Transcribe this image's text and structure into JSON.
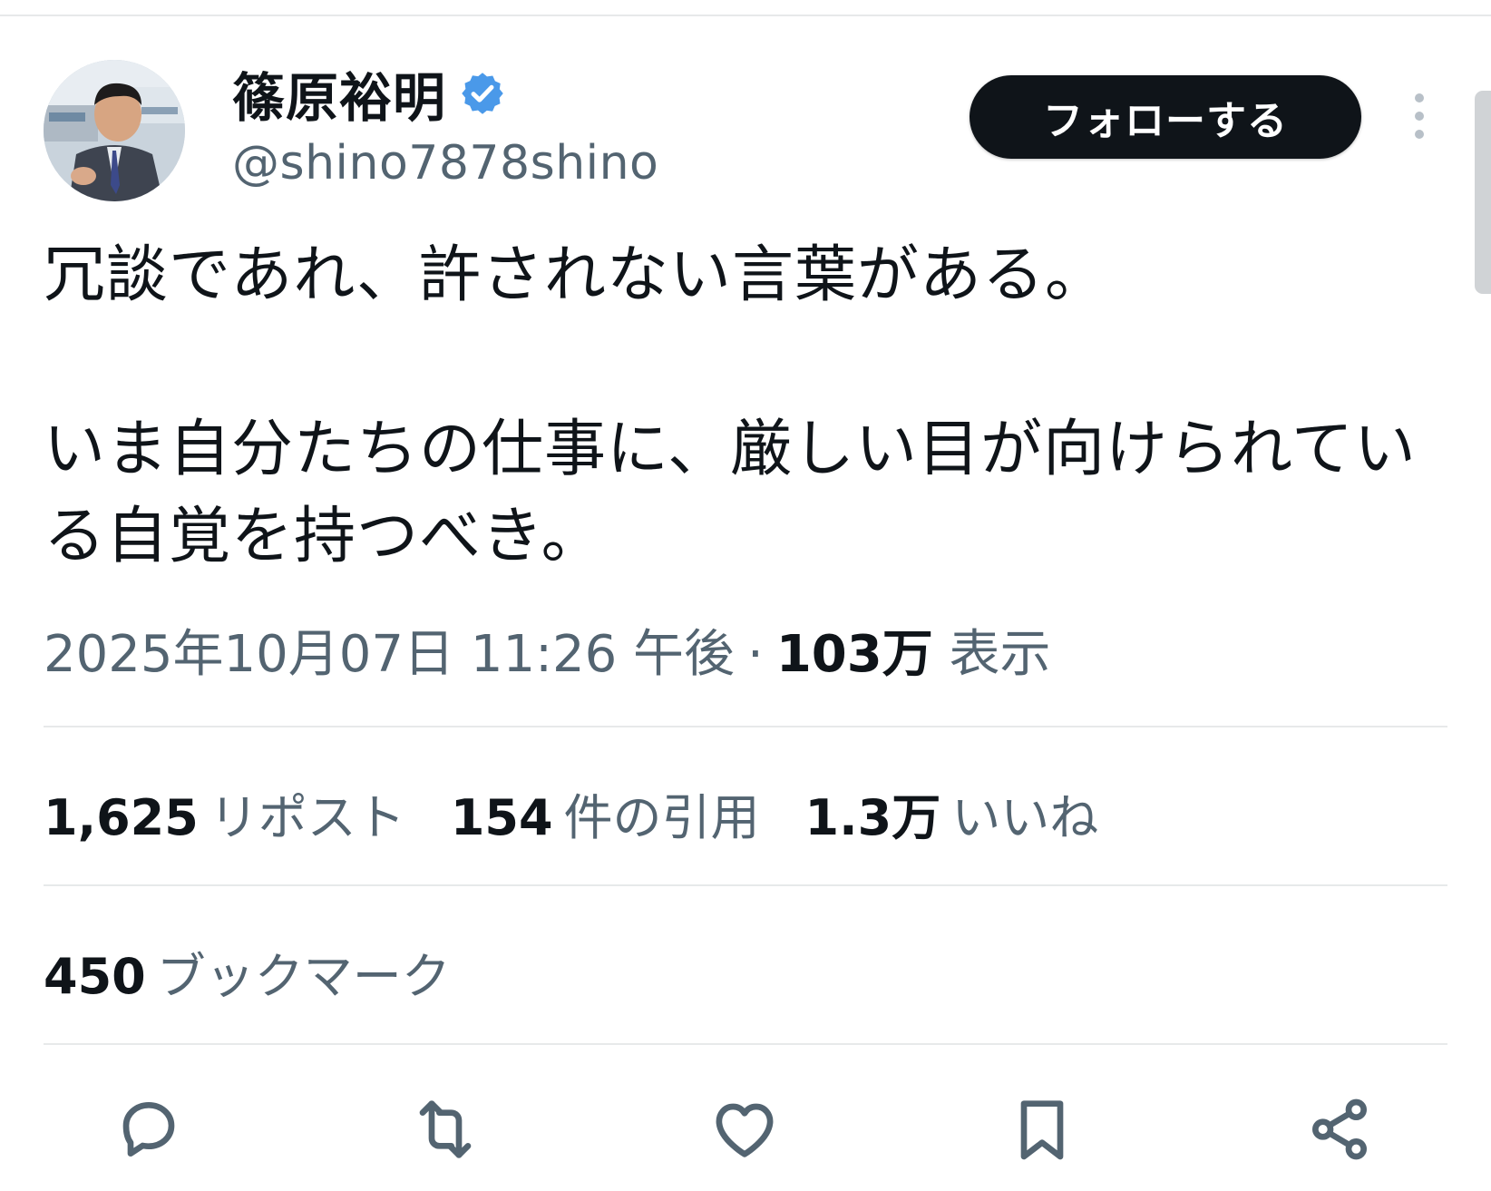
{
  "author": {
    "name": "篠原裕明",
    "handle": "@shino7878shino",
    "verified": true,
    "verified_color": "#4a99e9"
  },
  "follow_label": "フォローする",
  "tweet": {
    "text": "冗談であれ、許されない言葉がある。\n\nいま自分たちの仕事に、厳しい目が向けられている自覚を持つべき。"
  },
  "meta": {
    "datetime": "2025年10月07日 11:26 午後",
    "separator": "·",
    "views_count": "103万",
    "views_label": "表示"
  },
  "stats": {
    "reposts": {
      "count": "1,625",
      "label": "リポスト"
    },
    "quotes": {
      "count": "154",
      "label": "件の引用"
    },
    "likes": {
      "count": "1.3万",
      "label": "いいね"
    },
    "bookmarks": {
      "count": "450",
      "label": "ブックマーク"
    }
  },
  "actions": [
    {
      "icon": "reply-icon"
    },
    {
      "icon": "repost-icon"
    },
    {
      "icon": "like-icon"
    },
    {
      "icon": "bookmark-icon"
    },
    {
      "icon": "share-icon"
    }
  ],
  "colors": {
    "text": "#0f1419",
    "secondary": "#536471",
    "divider": "#e7e9ea",
    "follow_bg": "#0f1419",
    "follow_text": "#ffffff"
  }
}
